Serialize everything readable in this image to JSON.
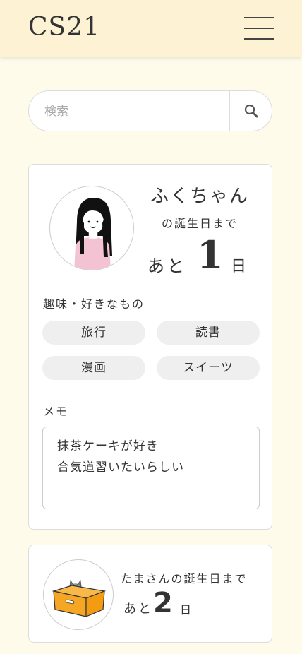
{
  "header": {
    "logo": "CS21",
    "menu_icon": "hamburger-menu-icon"
  },
  "search": {
    "placeholder": "検索",
    "value": "",
    "icon": "search-icon"
  },
  "cards": [
    {
      "name": "ふくちゃん",
      "until_label": "の誕生日まで",
      "count_prefix": "あと",
      "days": "1",
      "count_suffix": "日",
      "hobbies_label": "趣味・好きなもの",
      "hobbies": [
        "旅行",
        "読書",
        "漫画",
        "スイーツ"
      ],
      "memo_label": "メモ",
      "memo_lines": [
        "抹茶ケーキが好き",
        "合気道習いたいらしい"
      ]
    },
    {
      "until_label": "たまさんの誕生日まで",
      "count_prefix": "あと",
      "days": "2",
      "count_suffix": "日"
    }
  ],
  "colors": {
    "background": "#fffbea",
    "header": "#fdf3d4",
    "tag": "#efefef",
    "box": "#f5a623"
  }
}
